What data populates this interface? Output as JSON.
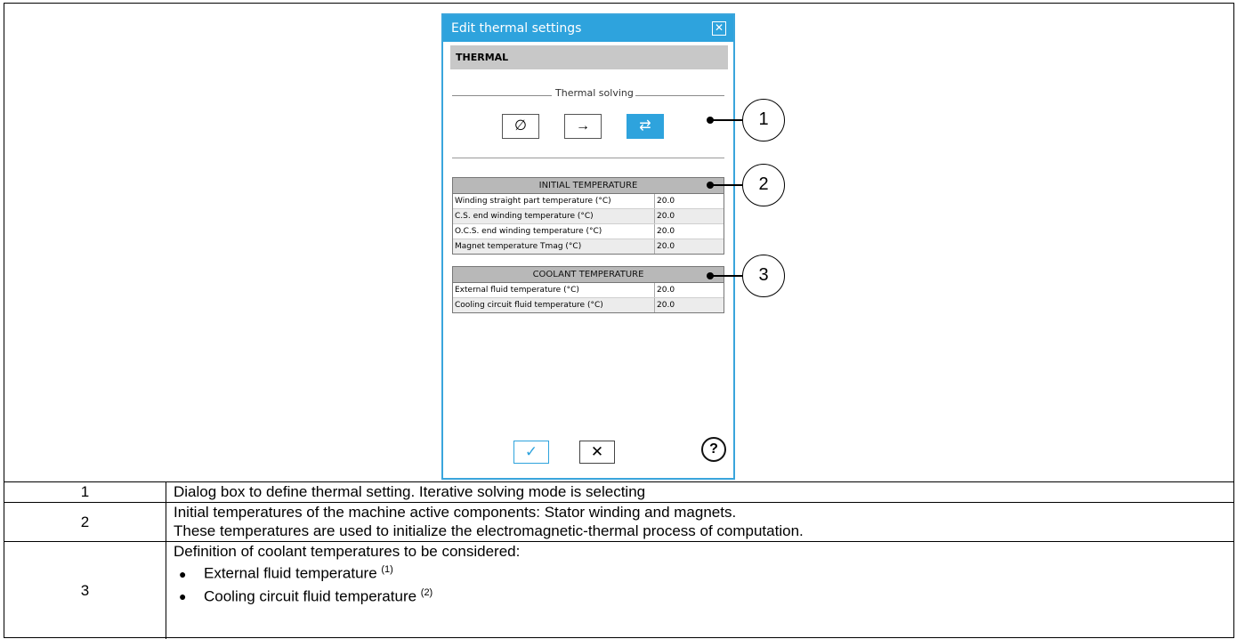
{
  "dialog": {
    "title": "Edit thermal settings",
    "close_icon": "close-icon",
    "section": "THERMAL",
    "group_label": "Thermal solving",
    "modes": [
      {
        "icon": "none-icon",
        "glyph": "∅",
        "active": false
      },
      {
        "icon": "arrow-right-icon",
        "glyph": "→",
        "active": false
      },
      {
        "icon": "swap-arrows-icon",
        "glyph": "⇄",
        "active": true
      }
    ],
    "initial_temperature": {
      "header": "INITIAL TEMPERATURE",
      "rows": [
        {
          "label": "Winding straight part temperature (°C)",
          "value": "20.0"
        },
        {
          "label": "C.S. end winding temperature (°C)",
          "value": "20.0"
        },
        {
          "label": "O.C.S. end winding temperature (°C)",
          "value": "20.0"
        },
        {
          "label": "Magnet temperature Tmag (°C)",
          "value": "20.0"
        }
      ]
    },
    "coolant_temperature": {
      "header": "COOLANT TEMPERATURE",
      "rows": [
        {
          "label": "External fluid temperature (°C)",
          "value": "20.0"
        },
        {
          "label": "Cooling circuit fluid temperature (°C)",
          "value": "20.0"
        }
      ]
    },
    "ok_glyph": "✓",
    "cancel_glyph": "✕",
    "help_glyph": "?"
  },
  "callouts": [
    "1",
    "2",
    "3"
  ],
  "rows": [
    {
      "num": "1",
      "lines": [
        "Dialog box to define thermal setting. Iterative solving mode is selecting"
      ]
    },
    {
      "num": "2",
      "lines": [
        "Initial temperatures of the machine active components: Stator winding and magnets.",
        "These temperatures are used to initialize the electromagnetic-thermal process of computation."
      ]
    },
    {
      "num": "3",
      "intro": "Definition of coolant temperatures to be considered:",
      "bullets": [
        {
          "text": "External fluid temperature ",
          "note": "(1)"
        },
        {
          "text": "Cooling circuit fluid temperature ",
          "note": "(2)"
        }
      ]
    }
  ],
  "colors": {
    "accent": "#2ea3dd"
  }
}
